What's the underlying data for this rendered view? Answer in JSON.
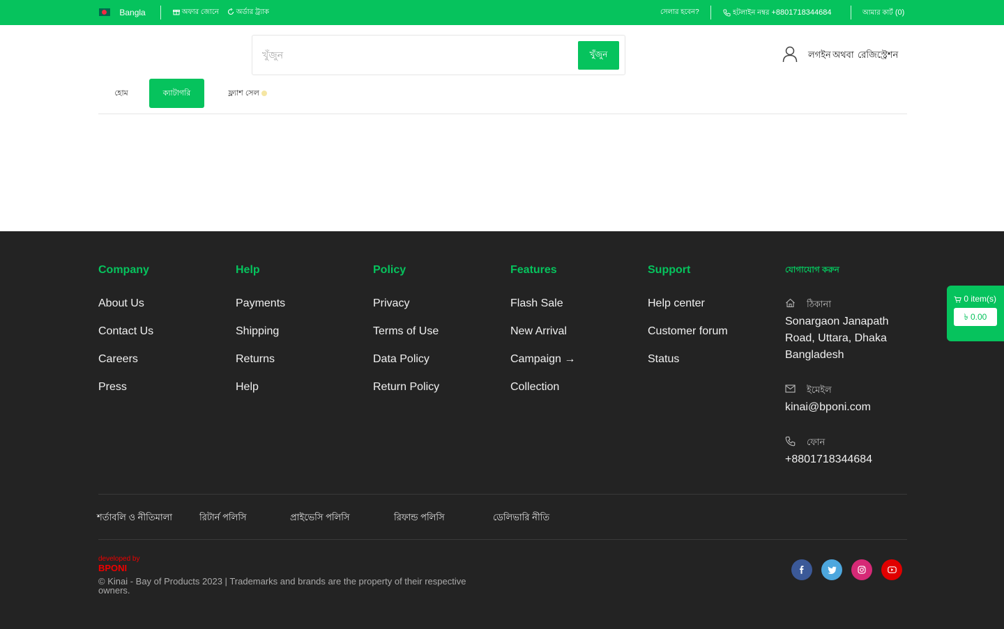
{
  "topbar": {
    "language": "Bangla",
    "offer_label": "অফার জোনে",
    "track_label": "অর্ডার ট্র্যাক",
    "become_seller": "সেলার হবেন?",
    "hotline_label": "হটলাইন নম্বর",
    "hotline_number": "+8801718344684",
    "cart_label": "আমার কার্ট",
    "cart_count": "(0)"
  },
  "search": {
    "placeholder": "খুঁজুন",
    "button_label": "খুঁজুন"
  },
  "auth": {
    "login": "লগইন",
    "or": "অথবা",
    "register": "রেজিস্ট্রেশন"
  },
  "nav": {
    "tabs": [
      "হোম",
      "ক্যাটাগরি",
      "ফ্ল্যাশ সেল"
    ]
  },
  "footer": {
    "columns": [
      {
        "title": "Company",
        "links": [
          "About Us",
          "Contact Us",
          "Careers",
          "Press"
        ]
      },
      {
        "title": "Help",
        "links": [
          "Payments",
          "Shipping",
          "Returns",
          "Help"
        ]
      },
      {
        "title": "Policy",
        "links": [
          "Privacy",
          "Terms of Use",
          "Data Policy",
          "Return Policy"
        ]
      },
      {
        "title": "Features",
        "links": [
          "Flash Sale",
          "New Arrival",
          "Campaign →",
          "Collection"
        ]
      },
      {
        "title": "Support",
        "links": [
          "Help center",
          "Customer forum",
          "Status"
        ]
      }
    ],
    "contact": {
      "title": "যোগাযোগ করুন",
      "address_label": "ঠিকানা",
      "address_line1": "Sonargaon Janapath",
      "address_line2": "Road, Uttara, Dhaka",
      "address_line3": "Bangladesh",
      "email_label": "ইমেইল",
      "email": "kinai@bponi.com",
      "phone_label": "ফোন",
      "phone": "+8801718344684"
    },
    "bottom_links": [
      "শর্তাবলি ও নীতিমালা",
      "রিটার্ন পলিসি",
      "প্রাইভেসি পলিসি",
      "রিফান্ড পলিসি",
      "ডেলিভারি নীতি"
    ],
    "developed_by": "developed by",
    "developer": "BPONI",
    "copyright": "© Kinai - Bay of Products 2023 | Trademarks and brands are the property of their respective owners."
  },
  "floating_cart": {
    "items": "0 item(s)",
    "price": "৳ 0.00"
  },
  "colors": {
    "brand_green": "#06c35d",
    "footer_bg": "#232323",
    "facebook": "#3b5998",
    "twitter": "#4da7de",
    "instagram": "#d62976",
    "youtube": "#e00000"
  },
  "icons": [
    "bangladesh-flag-icon",
    "gift-icon",
    "refresh-icon",
    "phone-icon",
    "user-icon",
    "home-icon",
    "mail-icon",
    "cart-icon",
    "facebook-icon",
    "twitter-icon",
    "instagram-icon",
    "youtube-icon"
  ]
}
